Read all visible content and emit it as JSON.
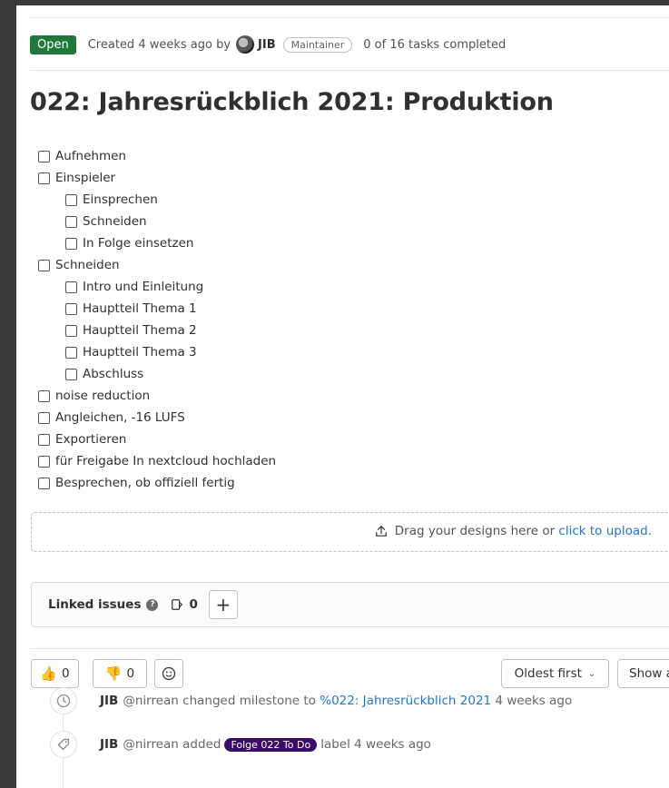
{
  "header": {
    "status": "Open",
    "created": "Created 4 weeks ago by",
    "author": "JIB",
    "role": "Maintainer",
    "tasks_summary": "0 of 16 tasks completed"
  },
  "title": "022: Jahresrückblich 2021: Produktion",
  "tasks": [
    {
      "label": "Aufnehmen",
      "level": 0
    },
    {
      "label": "Einspieler",
      "level": 0
    },
    {
      "label": "Einsprechen",
      "level": 1
    },
    {
      "label": "Schneiden",
      "level": 1
    },
    {
      "label": "In Folge einsetzen",
      "level": 1
    },
    {
      "label": "Schneiden",
      "level": 0
    },
    {
      "label": "Intro und Einleitung",
      "level": 1
    },
    {
      "label": "Hauptteil Thema 1",
      "level": 1
    },
    {
      "label": "Hauptteil Thema 2",
      "level": 1
    },
    {
      "label": "Hauptteil Thema 3",
      "level": 1
    },
    {
      "label": "Abschluss",
      "level": 1
    },
    {
      "label": "noise reduction",
      "level": 0
    },
    {
      "label": "Angleichen, -16 LUFS",
      "level": 0
    },
    {
      "label": "Exportieren",
      "level": 0
    },
    {
      "label": "für Freigabe In nextcloud hochladen",
      "level": 0
    },
    {
      "label": "Besprechen, ob offiziell fertig",
      "level": 0
    }
  ],
  "dropzone": {
    "text": "Drag your designs here or",
    "link": "click to upload",
    "suffix": "."
  },
  "linked_issues": {
    "title": "Linked issues",
    "count": "0",
    "add": "+"
  },
  "reactions": {
    "thumbs_up": "0",
    "thumbs_down": "0"
  },
  "controls": {
    "sort": "Oldest first",
    "show": "Show a"
  },
  "timeline": [
    {
      "author": "JIB",
      "handle": "@nirrean",
      "action": "changed milestone to",
      "link": "%022: Jahresrückblich 2021",
      "label": "",
      "time": "4 weeks ago"
    },
    {
      "author": "JIB",
      "handle": "@nirrean",
      "action": "added",
      "link": "",
      "label": "Folge 022 To Do",
      "suffix": "label",
      "time": "4 weeks ago"
    }
  ],
  "colors": {
    "status_open": "#1f7a3a",
    "link": "#1f75cb",
    "label": "#3b0a6b"
  }
}
